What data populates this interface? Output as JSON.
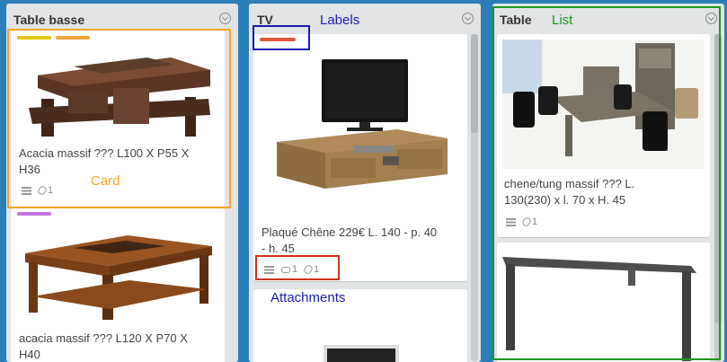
{
  "lists": [
    {
      "title": "Table basse",
      "cards": [
        {
          "labels": [
            "#e6c60d",
            "#f2a53b"
          ],
          "title_lines": [
            "Acacia massif ??? L100 X P55 X",
            "H36"
          ],
          "attachments": "1"
        },
        {
          "labels": [
            "#c377e0"
          ],
          "title_lines": [
            "acacia massif ??? L120 X P70 X",
            "H40"
          ]
        }
      ]
    },
    {
      "title": "TV",
      "cards": [
        {
          "labels": [
            "#e0593e"
          ],
          "title_lines": [
            "Plaqué Chêne 229€ L. 140 - p. 40",
            "- h. 45"
          ],
          "comments": "1",
          "attachments": "1"
        }
      ]
    },
    {
      "title": "Table",
      "cards": [
        {
          "title_lines": [
            "chene/tung massif ??? L.",
            "130(230) x l. 70 x H. 45"
          ],
          "attachments": "1"
        },
        {}
      ]
    }
  ],
  "annotations": {
    "card": "Card",
    "labels": "Labels",
    "list": "List",
    "attachments": "Attachments"
  },
  "colors": {
    "board_bg": "#2a7fb8",
    "annotation_orange": "#f5a623",
    "annotation_blue": "#1a1ab0",
    "annotation_green": "#1a9a1a",
    "annotation_red": "#d0321e"
  }
}
